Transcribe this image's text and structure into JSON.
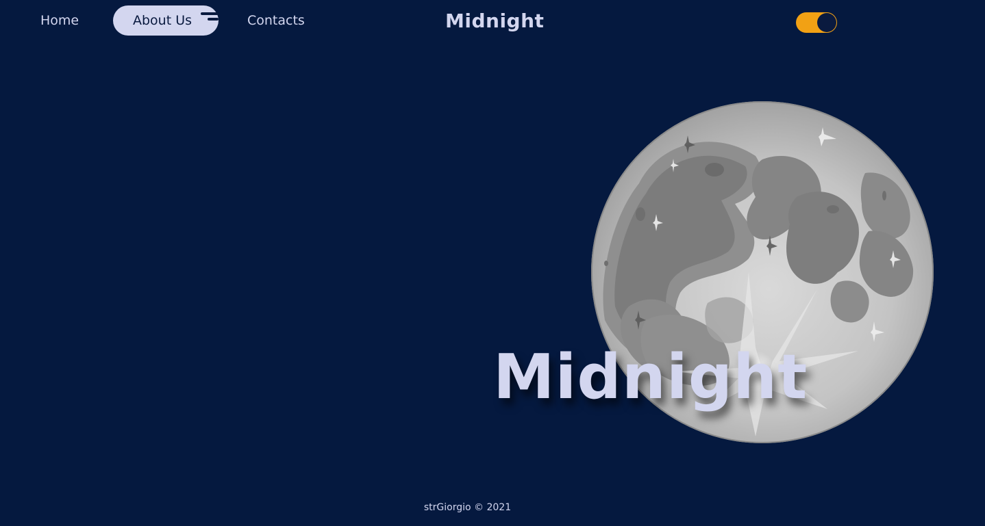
{
  "nav": {
    "items": [
      {
        "label": "Home",
        "active": false
      },
      {
        "label": "About Us",
        "active": true
      },
      {
        "label": "Contacts",
        "active": false
      }
    ],
    "menu_icon": "menu-icon"
  },
  "brand": "Midnight",
  "theme_toggle": {
    "state": "on",
    "track_color": "#f2a114",
    "knob_color": "#0a1a3f"
  },
  "hero": {
    "title": "Midnight",
    "image": "moon-illustration"
  },
  "footer": {
    "text": "strGiorgio © 2021"
  },
  "colors": {
    "background": "#05193f",
    "text": "#d3d6ef",
    "accent": "#f2a114"
  }
}
